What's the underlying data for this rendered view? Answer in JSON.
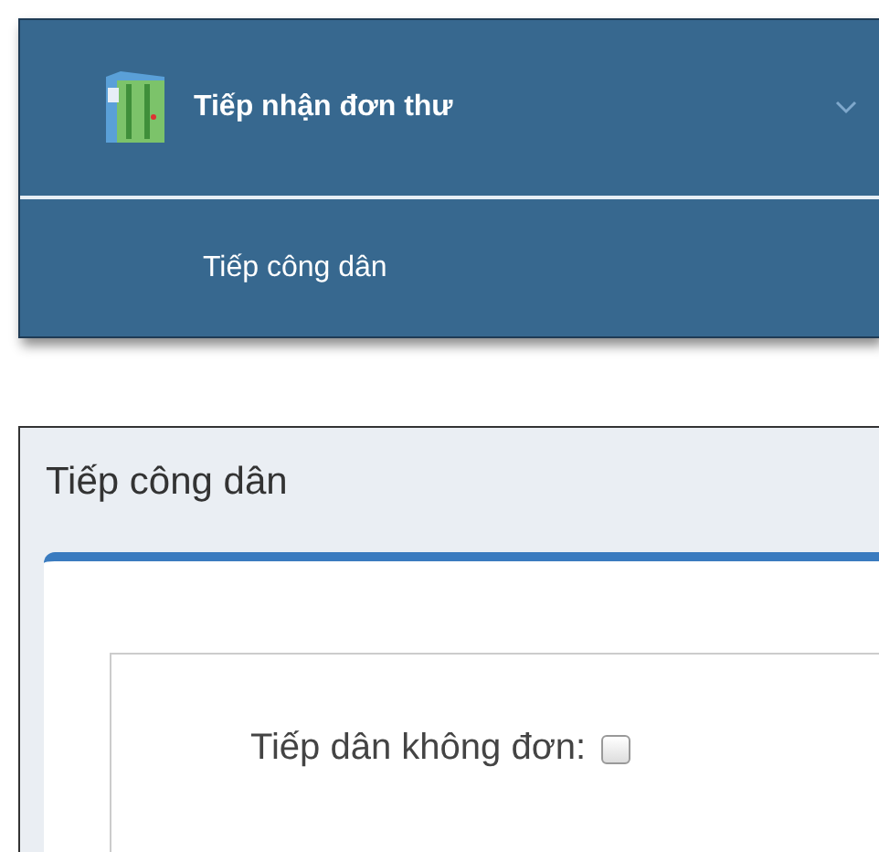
{
  "menu": {
    "title": "Tiếp nhận đơn thư",
    "expanded": true,
    "items": [
      {
        "label": "Tiếp công dân"
      }
    ]
  },
  "panel": {
    "title": "Tiếp công dân",
    "fields": [
      {
        "kind": "checkbox",
        "label": "Tiếp dân không đơn:",
        "checked": false
      }
    ]
  }
}
